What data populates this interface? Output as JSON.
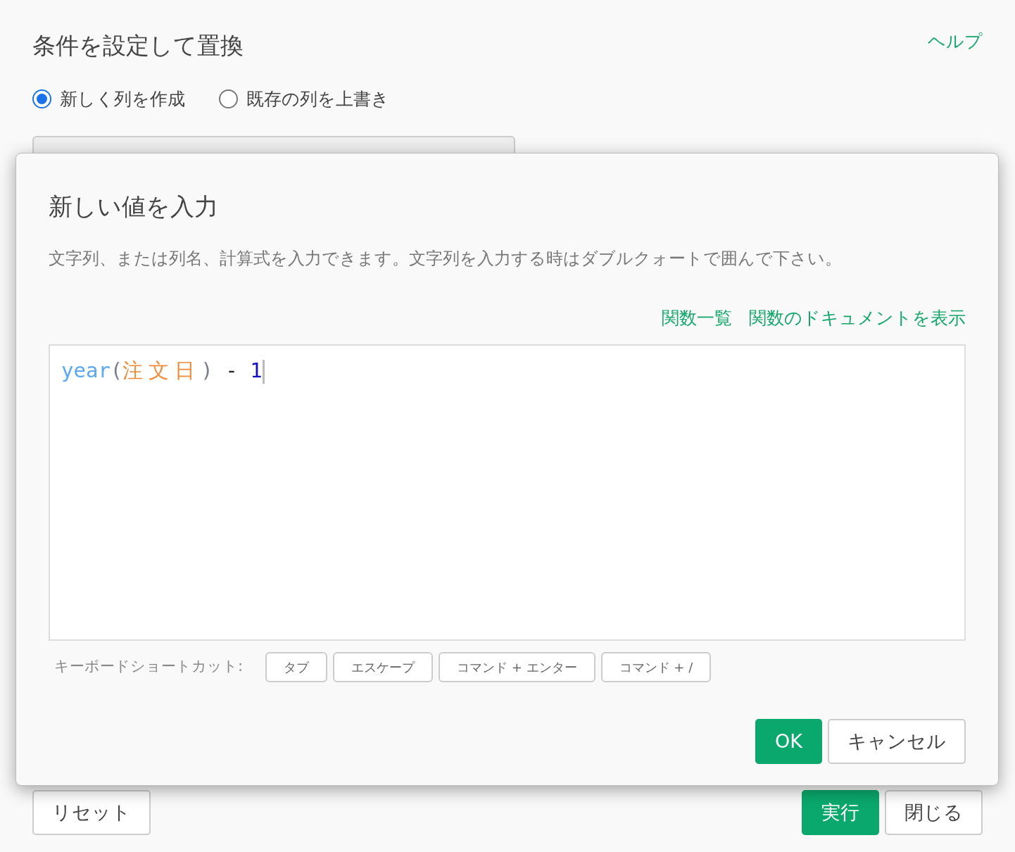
{
  "page": {
    "title": "条件を設定して置換",
    "help_link": "ヘルプ",
    "radios": [
      {
        "label": "新しく列を作成",
        "selected": true
      },
      {
        "label": "既存の列を上書き",
        "selected": false
      }
    ],
    "buttons": [
      {
        "label": "リセット",
        "kind": "secondary"
      },
      {
        "label": "実行",
        "kind": "primary"
      },
      {
        "label": "閉じる",
        "kind": "secondary"
      }
    ]
  },
  "dialog": {
    "title": "新しい値を入力",
    "description": "文字列、または列名、計算式を入力できます。文字列を入力する時はダブルクォートで囲んで下さい。",
    "links": [
      "関数一覧",
      "関数のドキュメントを表示"
    ],
    "editor": {
      "tokens": [
        {
          "text": "year",
          "kind": "function"
        },
        {
          "text": "(",
          "kind": "paren"
        },
        {
          "text": "注文日",
          "kind": "column"
        },
        {
          "text": ")",
          "kind": "paren"
        },
        {
          "text": " - ",
          "kind": "operator"
        },
        {
          "text": "1",
          "kind": "number"
        }
      ]
    },
    "shortcuts_label": "キーボードショートカット:",
    "shortcuts": [
      "タブ",
      "エスケープ",
      "コマンド + エンター",
      "コマンド + /"
    ],
    "buttons": [
      {
        "label": "OK",
        "kind": "primary"
      },
      {
        "label": "キャンセル",
        "kind": "secondary"
      }
    ]
  }
}
